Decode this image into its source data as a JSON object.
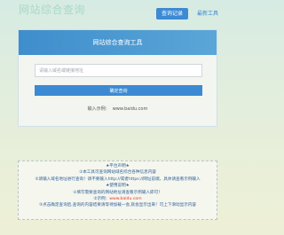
{
  "header": {
    "title": "网站综合查询",
    "records_button": "查询记录",
    "latest_link": "最新工具"
  },
  "tool": {
    "title": "网站综合查询工具",
    "input_placeholder": "请输入域名或链接地址",
    "input_value": "",
    "submit_label": "确定查询",
    "example_label": "输入示例：",
    "example_url": "www.baidu.com"
  },
  "info": {
    "declaration_heading": "★平台声明★",
    "declaration_1": "①本工具可查询网站域名综合各种信息内容",
    "declaration_2": "②请输入域名地址进行查询！请不要输入http://或者https://网址前缀，具体请查看示例输入",
    "usage_heading": "★使用说明★",
    "usage_1": "①填写需要查询的网站地址请查看示例输入即可！",
    "usage_2_prefix": "②示例：",
    "usage_2_site": "www.baidu.com",
    "usage_3": "③点击确定查询后,查询的内容结果请等待加载一会,就会显示出来！可上下滑动显示内容"
  },
  "colors": {
    "accent": "#3c8ad4",
    "header_gradient_start": "#3f8dcc",
    "highlight": "#e3342f",
    "title_faded": "#a9d8c9"
  }
}
